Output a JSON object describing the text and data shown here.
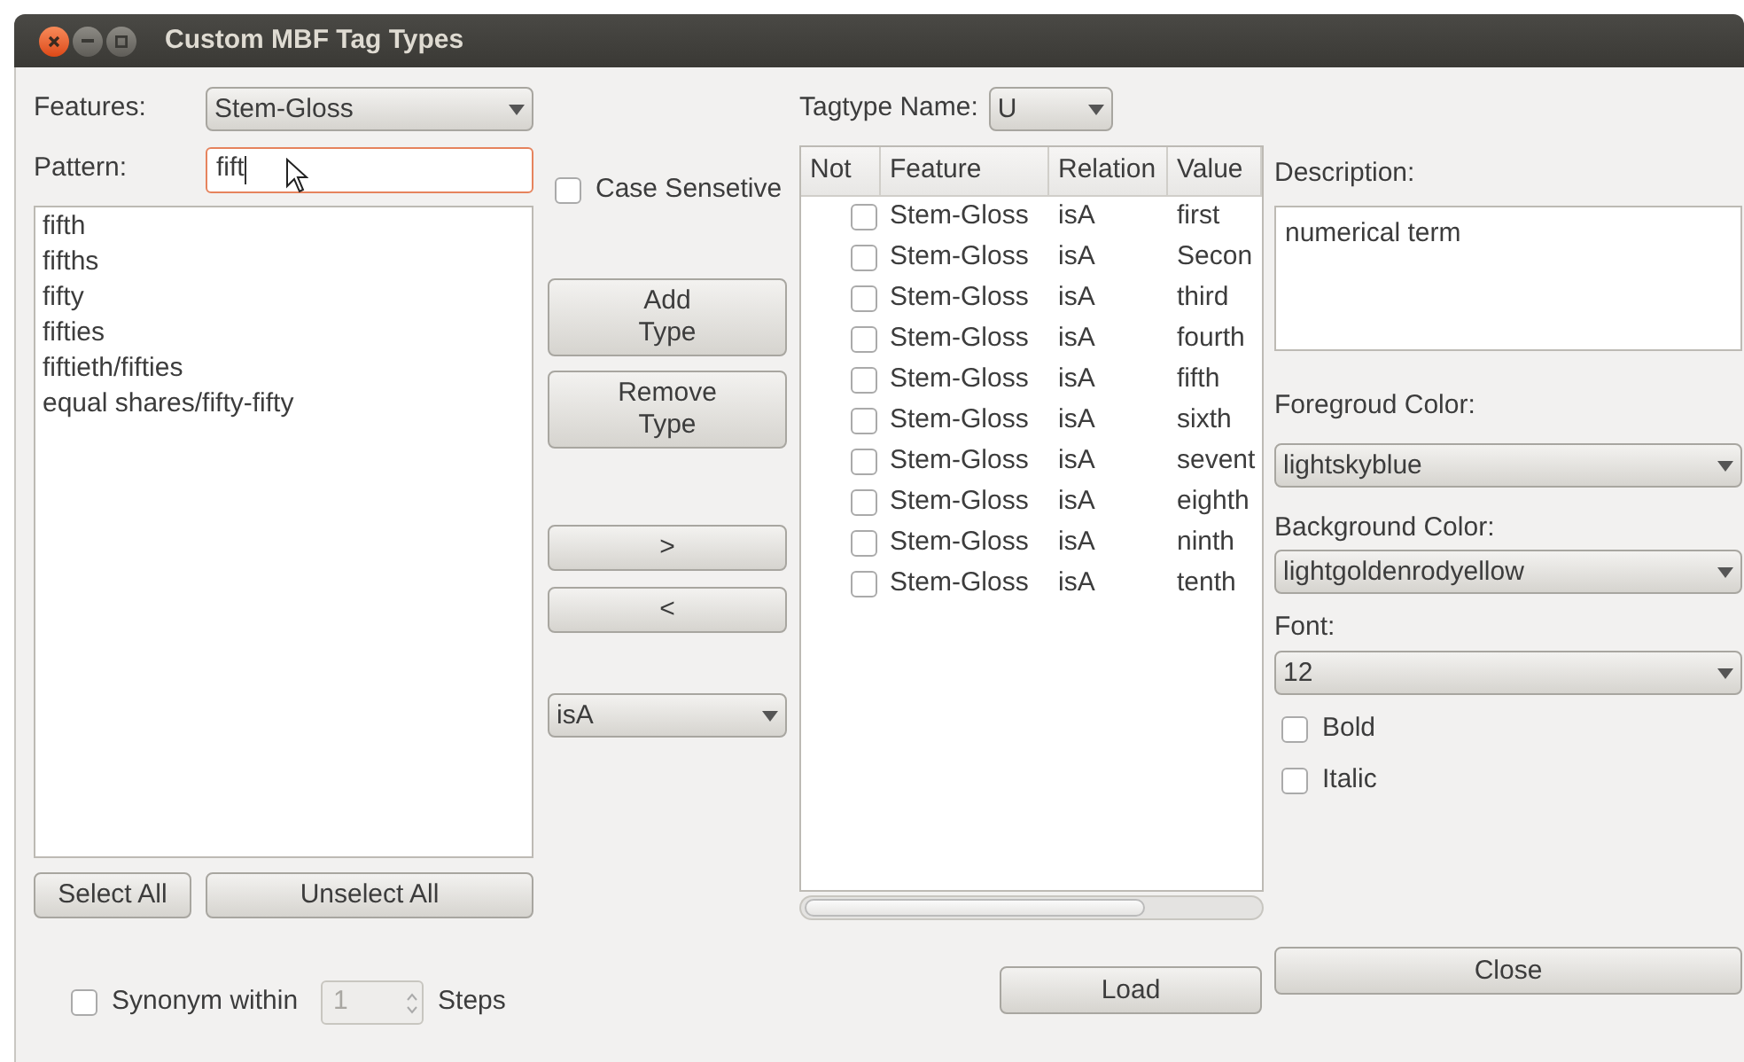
{
  "window": {
    "title": "Custom MBF Tag Types"
  },
  "features": {
    "label": "Features:",
    "value": "Stem-Gloss"
  },
  "pattern": {
    "label": "Pattern:",
    "value": "fift"
  },
  "case_sensitive": {
    "label": "Case Sensetive",
    "checked": false
  },
  "matches": [
    "fifth",
    "fifths",
    "fifty",
    "fifties",
    "fiftieth/fifties",
    "equal shares/fifty-fifty"
  ],
  "select_all": "Select All",
  "unselect_all": "Unselect All",
  "synonym": {
    "label": "Synonym within",
    "checked": false,
    "value": "1",
    "suffix": "Steps"
  },
  "add_type": [
    "Add",
    "Type"
  ],
  "remove_type": [
    "Remove",
    "Type"
  ],
  "move_right": ">",
  "move_left": "<",
  "relation": {
    "value": "isA"
  },
  "tagtype": {
    "label": "Tagtype Name:",
    "value": "U"
  },
  "table": {
    "columns": [
      "Not",
      "Feature",
      "Relation",
      "Value"
    ],
    "rows": [
      {
        "not": false,
        "feature": "Stem-Gloss",
        "relation": "isA",
        "value": "first"
      },
      {
        "not": false,
        "feature": "Stem-Gloss",
        "relation": "isA",
        "value": "Secon"
      },
      {
        "not": false,
        "feature": "Stem-Gloss",
        "relation": "isA",
        "value": "third"
      },
      {
        "not": false,
        "feature": "Stem-Gloss",
        "relation": "isA",
        "value": "fourth"
      },
      {
        "not": false,
        "feature": "Stem-Gloss",
        "relation": "isA",
        "value": "fifth"
      },
      {
        "not": false,
        "feature": "Stem-Gloss",
        "relation": "isA",
        "value": "sixth"
      },
      {
        "not": false,
        "feature": "Stem-Gloss",
        "relation": "isA",
        "value": "sevent"
      },
      {
        "not": false,
        "feature": "Stem-Gloss",
        "relation": "isA",
        "value": "eighth"
      },
      {
        "not": false,
        "feature": "Stem-Gloss",
        "relation": "isA",
        "value": "ninth"
      },
      {
        "not": false,
        "feature": "Stem-Gloss",
        "relation": "isA",
        "value": "tenth"
      }
    ]
  },
  "description": {
    "label": "Description:",
    "value": "numerical term"
  },
  "foreground": {
    "label": "Foregroud Color:",
    "value": "lightskyblue"
  },
  "background": {
    "label": "Background Color:",
    "value": "lightgoldenrodyellow"
  },
  "font": {
    "label": "Font:",
    "value": "12"
  },
  "bold": {
    "label": "Bold",
    "checked": false
  },
  "italic": {
    "label": "Italic",
    "checked": false
  },
  "load": "Load",
  "close": "Close"
}
